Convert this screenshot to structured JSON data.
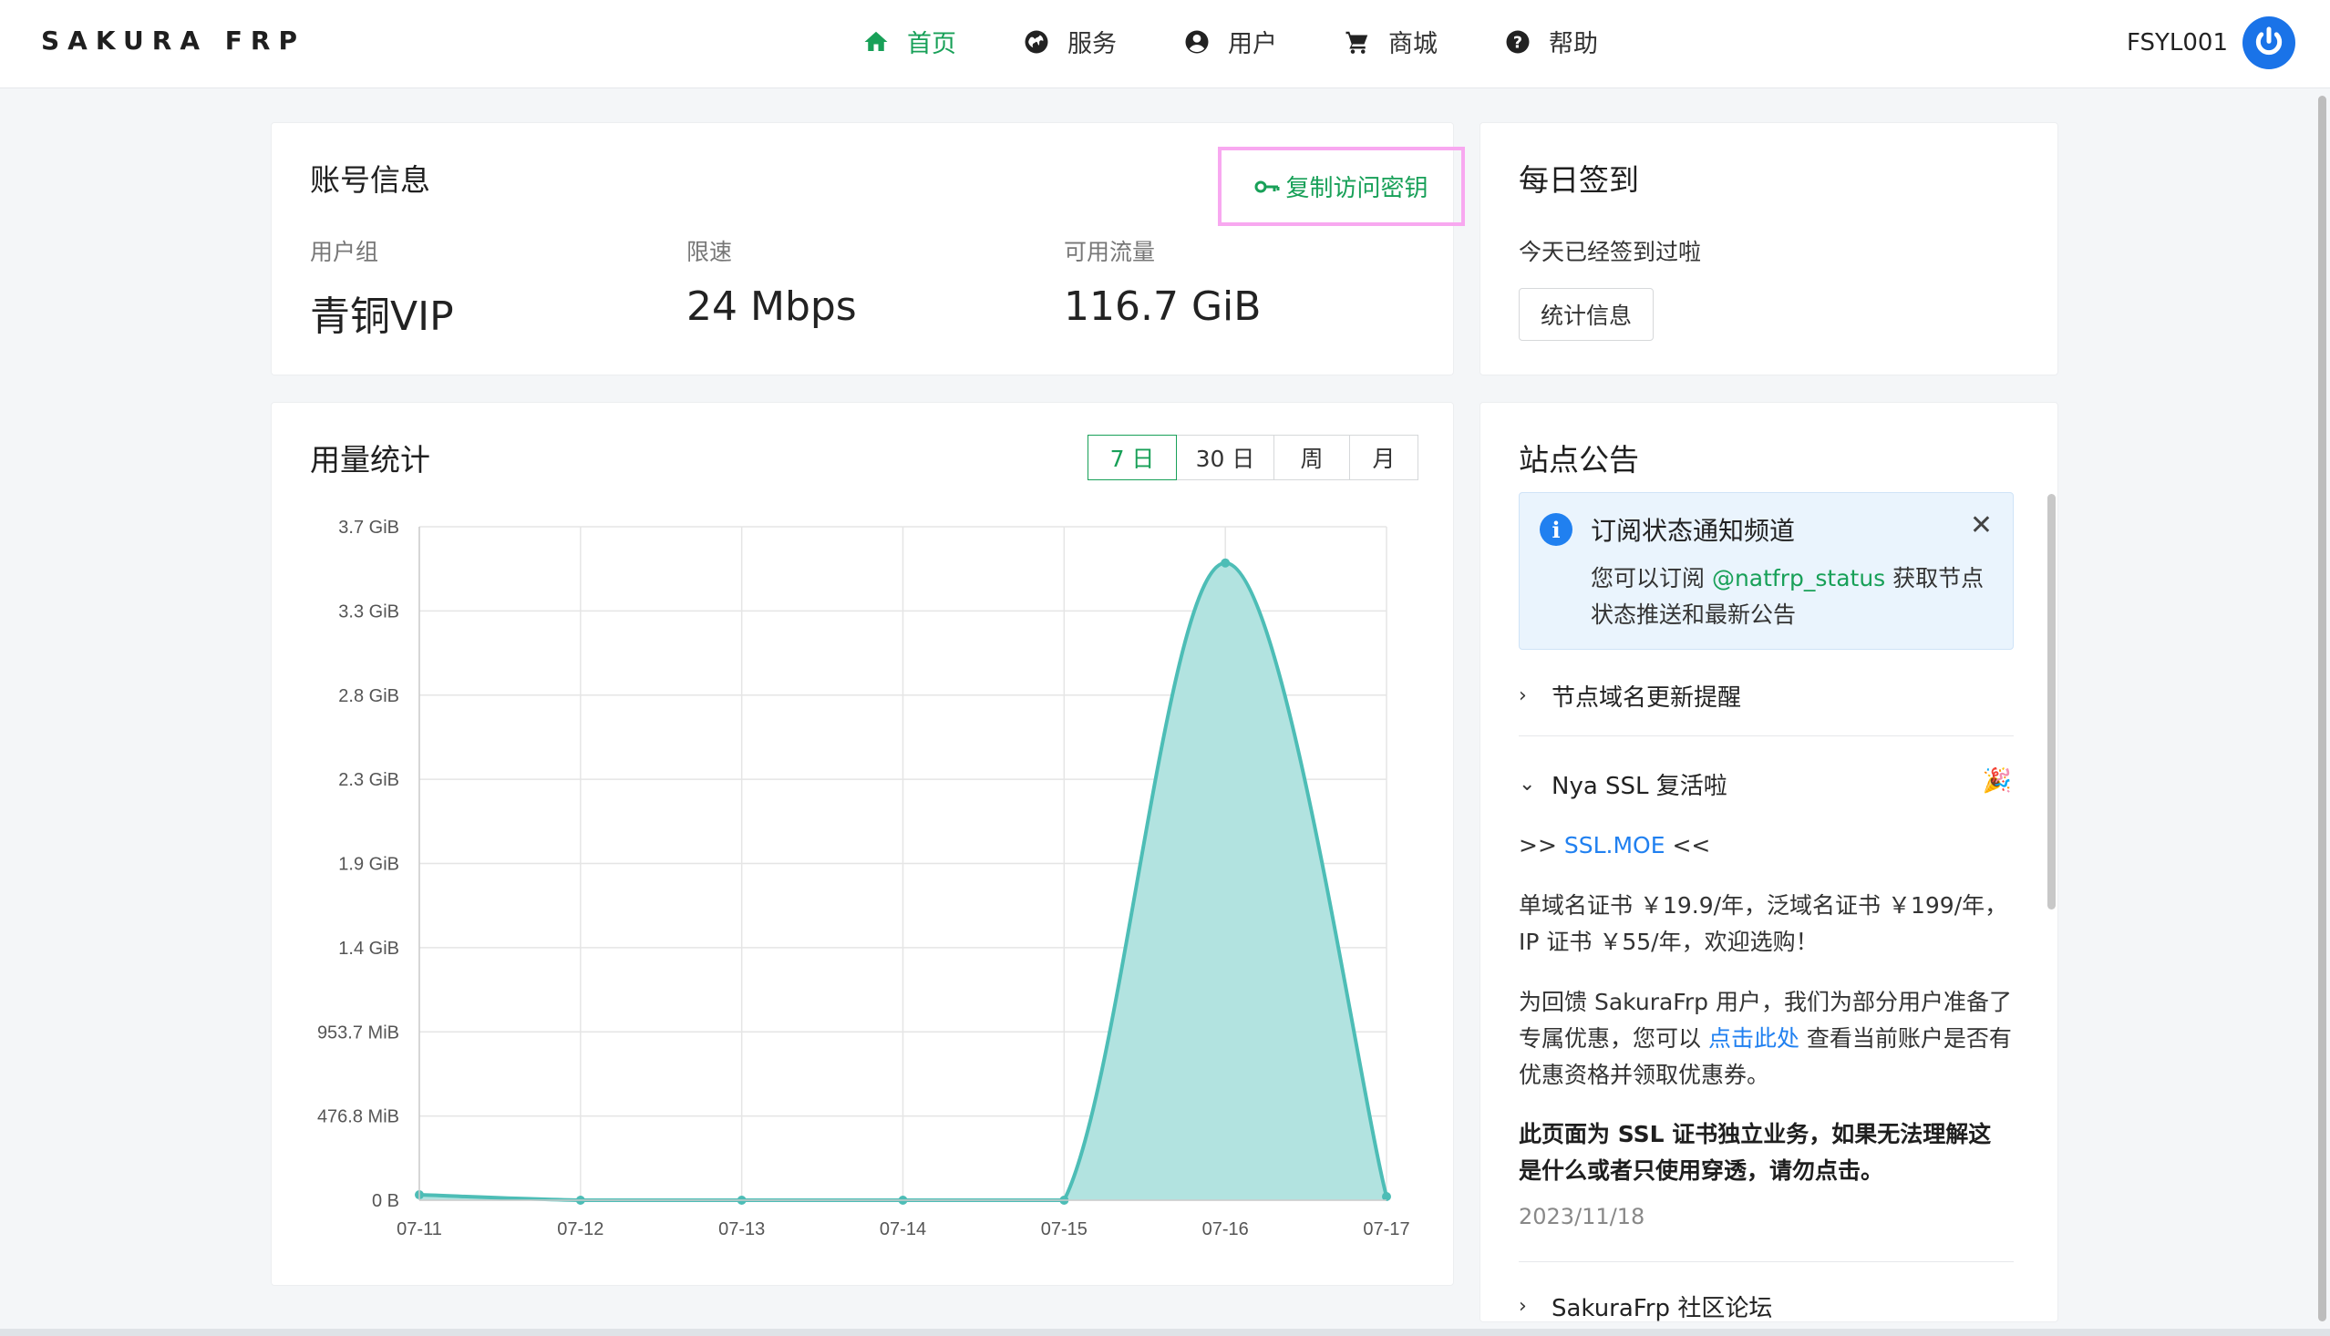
{
  "brand": "SAKURA FRP",
  "nav": [
    {
      "label": "首页",
      "icon": "home-icon",
      "active": true
    },
    {
      "label": "服务",
      "icon": "globe-icon",
      "active": false
    },
    {
      "label": "用户",
      "icon": "user-circle-icon",
      "active": false
    },
    {
      "label": "商城",
      "icon": "cart-icon",
      "active": false
    },
    {
      "label": "帮助",
      "icon": "help-icon",
      "active": false
    }
  ],
  "user": {
    "name": "FSYL001",
    "avatar_icon": "power-icon"
  },
  "account": {
    "title": "账号信息",
    "copy_key_label": "复制访问密钥",
    "stats": [
      {
        "label": "用户组",
        "value": "青铜VIP"
      },
      {
        "label": "限速",
        "value": "24 Mbps"
      },
      {
        "label": "可用流量",
        "value": "116.7 GiB"
      }
    ]
  },
  "checkin": {
    "title": "每日签到",
    "status": "今天已经签到过啦",
    "stats_button": "统计信息"
  },
  "usage": {
    "title": "用量统计",
    "ranges": [
      "7 日",
      "30 日",
      "周",
      "月"
    ],
    "active_range": 0
  },
  "chart_data": {
    "type": "area",
    "x": [
      "07-11",
      "07-12",
      "07-13",
      "07-14",
      "07-15",
      "07-16",
      "07-17"
    ],
    "y_ticks": [
      "0 B",
      "476.8 MiB",
      "953.7 MiB",
      "1.4 GiB",
      "1.9 GiB",
      "2.3 GiB",
      "2.8 GiB",
      "3.3 GiB",
      "3.7 GiB"
    ],
    "ylim_gib": [
      0,
      3.72
    ],
    "series": [
      {
        "values_gib": [
          0.03,
          0.0,
          0.0,
          0.0,
          0.0,
          3.52,
          0.02
        ]
      }
    ],
    "color": "#4dbdb6",
    "fill": "#b2e3e0",
    "grid": true
  },
  "notice": {
    "title": "站点公告",
    "alert": {
      "title": "订阅状态通知频道",
      "body_prefix": "您可以订阅 ",
      "body_link": "@natfrp_status",
      "body_suffix": " 获取节点状态推送和最新公告"
    },
    "item1": "节点域名更新提醒",
    "item2": "Nya SSL 复活啦",
    "item2_icon": "party-popper-icon",
    "ssl_prefix": ">> ",
    "ssl_link": "SSL.MOE",
    "ssl_suffix": " <<",
    "para1": "单域名证书 ￥19.9/年，泛域名证书 ￥199/年，IP 证书 ￥55/年，欢迎选购！",
    "para2_prefix": "为回馈 SakuraFrp 用户，我们为部分用户准备了专属优惠，您可以 ",
    "para2_link": "点击此处",
    "para2_suffix": " 查看当前账户是否有优惠资格并领取优惠券。",
    "para3": "此页面为 SSL 证书独立业务，如果无法理解这是什么或者只使用穿透，请勿点击。",
    "date": "2023/11/18",
    "item3": "SakuraFrp 社区论坛"
  }
}
